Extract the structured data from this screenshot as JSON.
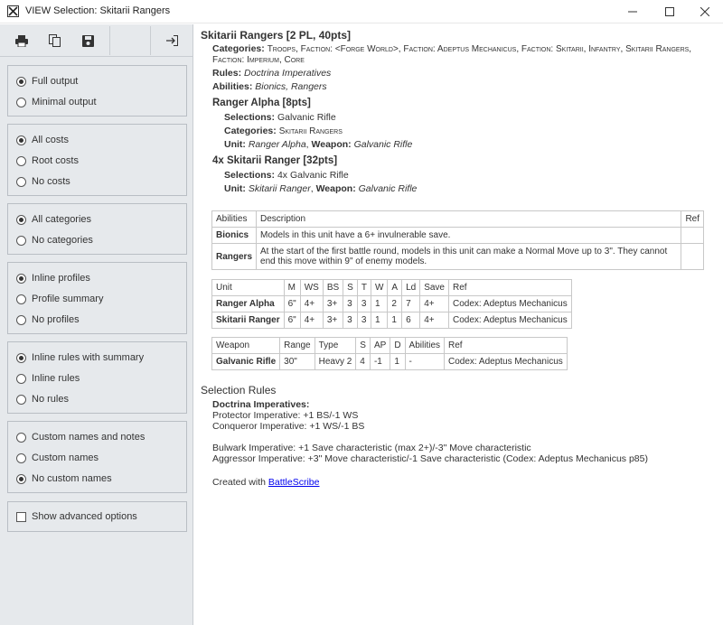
{
  "window": {
    "title": "VIEW Selection: Skitarii Rangers"
  },
  "toolbar": {
    "print_icon": "printer-icon",
    "copy_icon": "copy-icon",
    "save_icon": "save-icon",
    "exit_icon": "exit-icon"
  },
  "options": {
    "output": [
      "Full output",
      "Minimal output"
    ],
    "costs": [
      "All costs",
      "Root costs",
      "No costs"
    ],
    "categories": [
      "All categories",
      "No categories"
    ],
    "profiles": [
      "Inline profiles",
      "Profile summary",
      "No profiles"
    ],
    "rules": [
      "Inline rules with summary",
      "Inline rules",
      "No rules"
    ],
    "names": [
      "Custom names and notes",
      "Custom names",
      "No custom names"
    ],
    "advanced": "Show advanced options"
  },
  "unit": {
    "title": "Skitarii Rangers [2 PL, 40pts]",
    "categories_label": "Categories:",
    "categories_line1": "Troops, Faction: <Forge World>, Faction: Adeptus Mechanicus, Faction: Skitarii, Infantry, Skitarii Rangers,",
    "categories_line2": "Faction: Imperium, Core",
    "rules_label": "Rules:",
    "rules_value": "Doctrina Imperatives",
    "abilities_label": "Abilities:",
    "abilities_value": "Bionics, Rangers"
  },
  "alpha": {
    "title": "Ranger Alpha [8pts]",
    "selections_label": "Selections:",
    "selections_value": "Galvanic Rifle",
    "categories_label": "Categories:",
    "categories_value": "Skitarii Rangers",
    "unit_label": "Unit:",
    "unit_value": "Ranger Alpha",
    "weapon_label": "Weapon:",
    "weapon_value": "Galvanic Rifle"
  },
  "ranger": {
    "title": "4x Skitarii Ranger [32pts]",
    "selections_label": "Selections:",
    "selections_value": "4x Galvanic Rifle",
    "unit_label": "Unit:",
    "unit_value": "Skitarii Ranger",
    "weapon_label": "Weapon:",
    "weapon_value": "Galvanic Rifle"
  },
  "abilities_table": {
    "headers": [
      "Abilities",
      "Description",
      "Ref"
    ],
    "rows": [
      {
        "name": "Bionics",
        "desc1": "Models in this unit have a 6+ invulnerable save.",
        "desc2": ""
      },
      {
        "name": "Rangers",
        "desc1": "At the start of the first battle round, models in this unit can make a Normal Move up to 3\". They cannot",
        "desc2": "end this move within 9\" of enemy models."
      }
    ]
  },
  "unit_table": {
    "headers": [
      "Unit",
      "M",
      "WS",
      "BS",
      "S",
      "T",
      "W",
      "A",
      "Ld",
      "Save",
      "Ref"
    ],
    "rows": [
      [
        "Ranger Alpha",
        "6\"",
        "4+",
        "3+",
        "3",
        "3",
        "1",
        "2",
        "7",
        "4+",
        "Codex: Adeptus Mechanicus"
      ],
      [
        "Skitarii Ranger",
        "6\"",
        "4+",
        "3+",
        "3",
        "3",
        "1",
        "1",
        "6",
        "4+",
        "Codex: Adeptus Mechanicus"
      ]
    ]
  },
  "weapon_table": {
    "headers": [
      "Weapon",
      "Range",
      "Type",
      "S",
      "AP",
      "D",
      "Abilities",
      "Ref"
    ],
    "rows": [
      [
        "Galvanic Rifle",
        "30\"",
        "Heavy 2",
        "4",
        "-1",
        "1",
        "-",
        "Codex: Adeptus Mechanicus"
      ]
    ]
  },
  "selection_rules": {
    "title": "Selection Rules",
    "rule_name": "Doctrina Imperatives:",
    "lines": [
      "Protector Imperative: +1 BS/-1 WS",
      "Conqueror Imperative: +1 WS/-1 BS",
      "",
      "Bulwark Imperative: +1 Save characteristic (max 2+)/-3\" Move characteristic",
      "Aggressor Imperative: +3\" Move characteristic/-1 Save characteristic (Codex: Adeptus Mechanicus p85)"
    ]
  },
  "footer": {
    "created_with": "Created with",
    "link": "BattleScribe"
  }
}
